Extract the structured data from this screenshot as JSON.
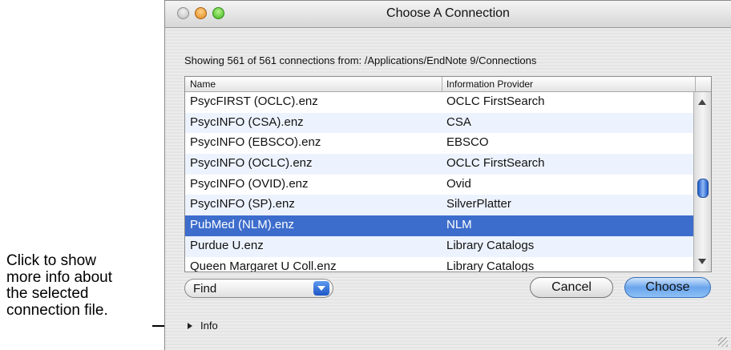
{
  "callout": {
    "lines": [
      "Click to show",
      "more info about",
      "the selected",
      "connection file."
    ]
  },
  "window": {
    "title": "Choose A Connection"
  },
  "status_text": "Showing 561 of 561 connections from: /Applications/EndNote 9/Connections",
  "table": {
    "columns": [
      "Name",
      "Information Provider"
    ],
    "rows": [
      {
        "name": "PsycFIRST (OCLC).enz",
        "provider": "OCLC FirstSearch"
      },
      {
        "name": "PsycINFO (CSA).enz",
        "provider": "CSA"
      },
      {
        "name": "PsycINFO (EBSCO).enz",
        "provider": "EBSCO"
      },
      {
        "name": "PsycINFO (OCLC).enz",
        "provider": "OCLC FirstSearch"
      },
      {
        "name": "PsycINFO (OVID).enz",
        "provider": "Ovid"
      },
      {
        "name": "PsycINFO (SP).enz",
        "provider": "SilverPlatter"
      },
      {
        "name": "PubMed (NLM).enz",
        "provider": "NLM"
      },
      {
        "name": "Purdue U.enz",
        "provider": "Library Catalogs"
      },
      {
        "name": "Queen Margaret U Coll.enz",
        "provider": "Library Catalogs"
      }
    ]
  },
  "selected_row": 6,
  "find": {
    "label": "Find"
  },
  "buttons": {
    "cancel": "Cancel",
    "choose": "Choose"
  },
  "info": {
    "label": "Info"
  },
  "colors": {
    "selection": "#3d6dcc",
    "stripe": "#edf3fe"
  }
}
